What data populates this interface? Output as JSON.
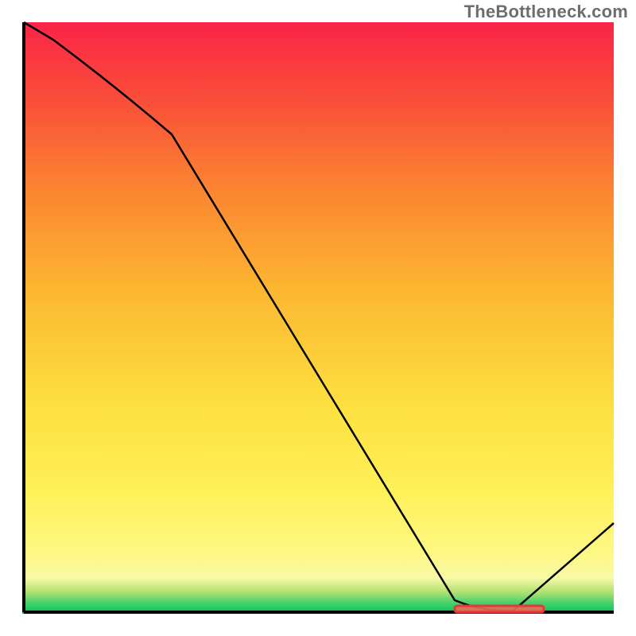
{
  "watermark": "TheBottleneck.com",
  "chart_data": {
    "type": "line",
    "title": "",
    "xlabel": "",
    "ylabel": "",
    "xlim": [
      0,
      100
    ],
    "ylim": [
      0,
      100
    ],
    "grid": false,
    "legend": false,
    "x": [
      0,
      5,
      25,
      73,
      83,
      100
    ],
    "y": [
      100,
      97,
      81,
      2,
      0,
      15
    ],
    "optimal_band": {
      "x_start": 73,
      "x_end": 88,
      "y": 0
    },
    "gradient_stops": [
      {
        "pct": 0,
        "color": "#00c25a"
      },
      {
        "pct": 2,
        "color": "#4fd36f"
      },
      {
        "pct": 3.5,
        "color": "#a9e06f"
      },
      {
        "pct": 6,
        "color": "#f8f9a6"
      },
      {
        "pct": 10,
        "color": "#fef885"
      },
      {
        "pct": 20,
        "color": "#fef15a"
      },
      {
        "pct": 35,
        "color": "#fde03f"
      },
      {
        "pct": 55,
        "color": "#fcb631"
      },
      {
        "pct": 72,
        "color": "#fb8431"
      },
      {
        "pct": 88,
        "color": "#fa4a3a"
      },
      {
        "pct": 100,
        "color": "#fa2448"
      }
    ]
  }
}
